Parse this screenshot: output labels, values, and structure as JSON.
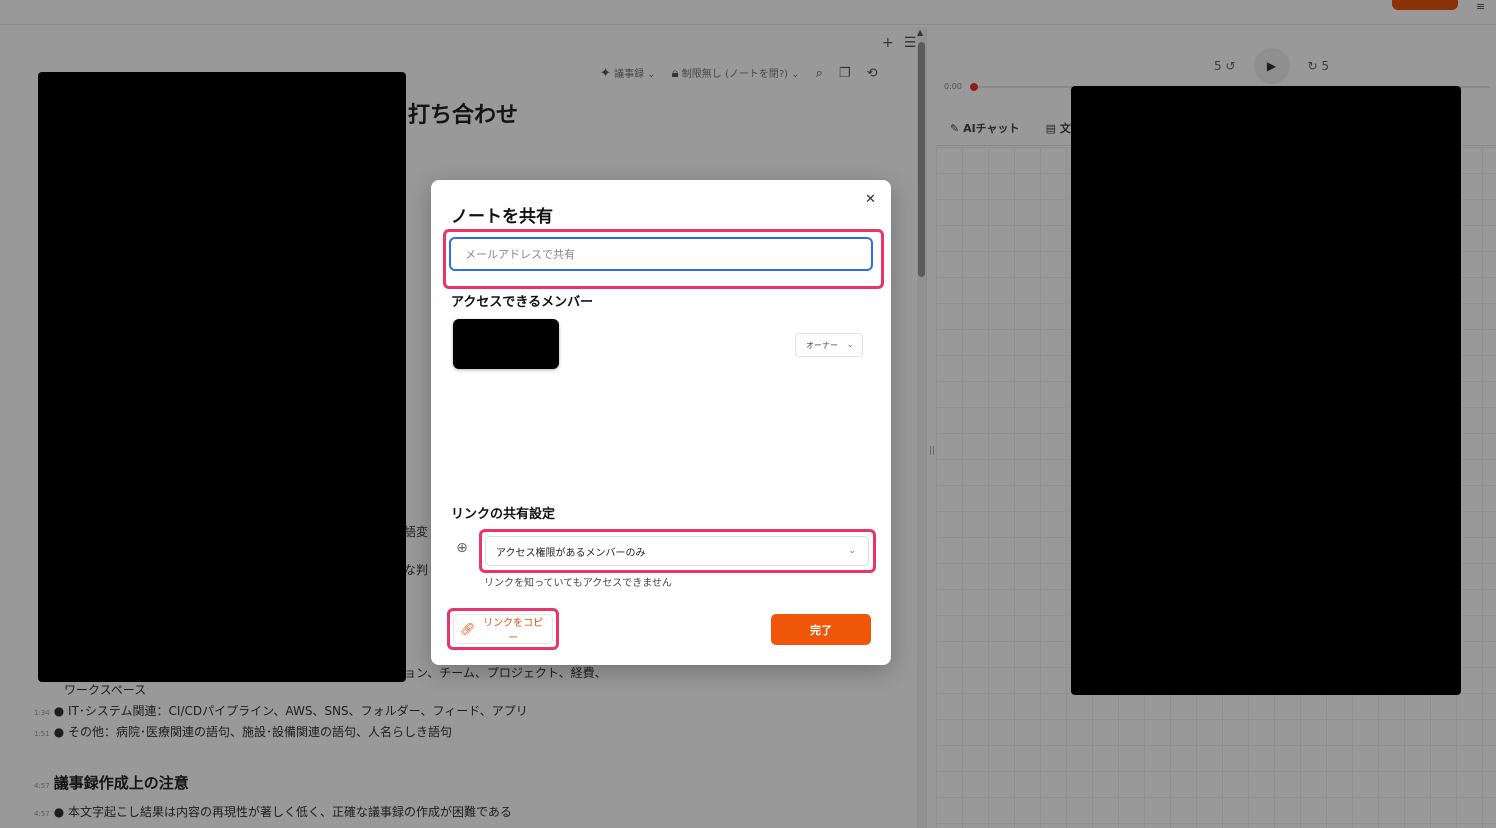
{
  "app": {
    "toolbar": {
      "item1": "議事録",
      "item2": "制限無し (ノートを閉?)"
    },
    "doc_title": "打ち合わせ",
    "bullets": [
      {
        "ts": "",
        "text": "ワークスペース"
      },
      {
        "ts": "1:34",
        "text": "IT･システム関連：CI/CDパイプライン、AWS、SNS、フォルダー、フィード、アプリ"
      },
      {
        "ts": "1:51",
        "text": "その他：病院･医療関連の語句、施設･設備関連の語句、人名らしき語句"
      }
    ],
    "fragments": {
      "frag1": "語変",
      "frag2": "な判",
      "frag3": "ョン、チーム、プロジェクト、経費、"
    },
    "section": {
      "ts": "4:57",
      "title": "議事録作成上の注意"
    },
    "section_bullet": {
      "ts": "4:57",
      "text": "本文字起こし結果は内容の再現性が著しく低く、正確な議事録の作成が困難である"
    },
    "player": {
      "rewind": "5",
      "forward": "5",
      "time": "0:00"
    },
    "right_tabs": {
      "ai_chat": "AIチャット",
      "text": "文字"
    },
    "top_menu": "≡"
  },
  "modal": {
    "title": "ノートを共有",
    "email_placeholder": "メールアドレスで共有",
    "members_label": "アクセスできるメンバー",
    "role": "オーナー",
    "link_settings_label": "リンクの共有設定",
    "access_option": "アクセス権限があるメンバーのみ",
    "access_note": "リンクを知っていてもアクセスできません",
    "copy_link": "リンクをコピー",
    "done": "完了"
  }
}
